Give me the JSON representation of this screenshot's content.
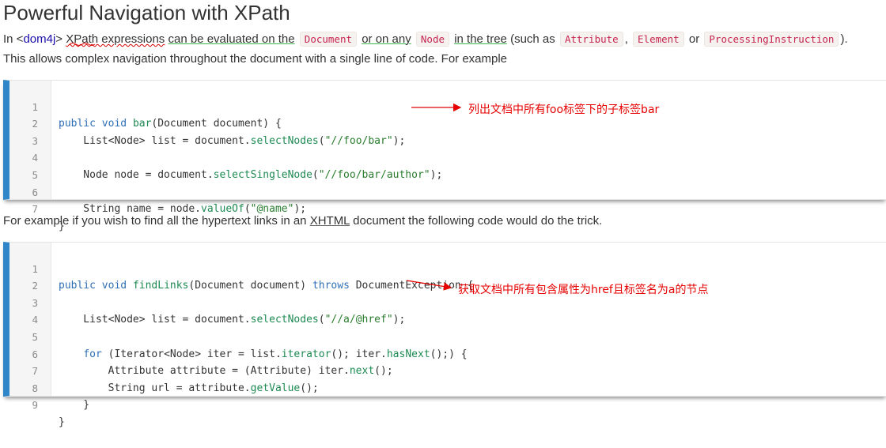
{
  "title": "Powerful Navigation with XPath",
  "intro": {
    "t_in": "In <",
    "dom4j": "dom4j",
    "t_gt": "> ",
    "xpath": "XPath expressions",
    "t_space": " ",
    "can_eval": "can be evaluated on the",
    "code_document": "Document",
    "or_on_any": "or on any",
    "code_node": "Node",
    "in_tree": "in the tree",
    "such_as": "(such as",
    "code_attribute": "Attribute",
    "comma": ",",
    "code_element": "Element",
    "or": "or",
    "code_pi": "ProcessingInstruction",
    "close": ").",
    "line2": "This allows complex navigation throughout the document with a single line of code. For example"
  },
  "para3": {
    "before": "For example if you wish to find all the hypertext links in an ",
    "xhtml": "XHTML",
    "after": " document the following code would do the trick."
  },
  "code1": {
    "numbers": [
      "1",
      "2",
      "3",
      "4",
      "5",
      "6",
      "7"
    ],
    "l1": {
      "kw1": "public",
      "kw2": "void",
      "fn": "bar",
      "rest": "(Document document) {"
    },
    "l2": {
      "a": "    List<Node> list = document.",
      "fn": "selectNodes",
      "b": "(",
      "str": "\"//foo/bar\"",
      "c": ");"
    },
    "l4": {
      "a": "    Node node = document.",
      "fn": "selectSingleNode",
      "b": "(",
      "str": "\"//foo/bar/author\"",
      "c": ");"
    },
    "l6": {
      "a": "    String name = node.",
      "fn": "valueOf",
      "b": "(",
      "str": "\"@name\"",
      "c": ");"
    },
    "l7": "}",
    "annotation": "列出文档中所有foo标签下的子标签bar"
  },
  "code2": {
    "numbers": [
      "1",
      "2",
      "3",
      "4",
      "5",
      "6",
      "7",
      "8",
      "9"
    ],
    "l1": {
      "kw1": "public",
      "kw2": "void",
      "fn": "findLinks",
      "rest1": "(Document document) ",
      "kw3": "throws",
      "rest2": " DocumentException {"
    },
    "l3": {
      "a": "    List<Node> list = document.",
      "fn": "selectNodes",
      "b": "(",
      "str": "\"//a/@href\"",
      "c": ");"
    },
    "l5": {
      "kw": "for",
      "a": " (Iterator<Node> iter = list.",
      "fn1": "iterator",
      "b": "(); iter.",
      "fn2": "hasNext",
      "c": "();) {"
    },
    "l6": {
      "a": "        Attribute attribute = (Attribute) iter.",
      "fn": "next",
      "b": "();"
    },
    "l7": {
      "a": "        String url = attribute.",
      "fn": "getValue",
      "b": "();"
    },
    "l8": "    }",
    "l9": "}",
    "annotation": "获取文档中所有包含属性为href且标签名为a的节点"
  },
  "colors": {
    "accent_bar": "#2f86c9",
    "annotation": "#e60000",
    "keyword": "#2f6fb5",
    "function": "#1d8a52",
    "string": "#2a7d2f",
    "inline_code": "#c7254e"
  }
}
